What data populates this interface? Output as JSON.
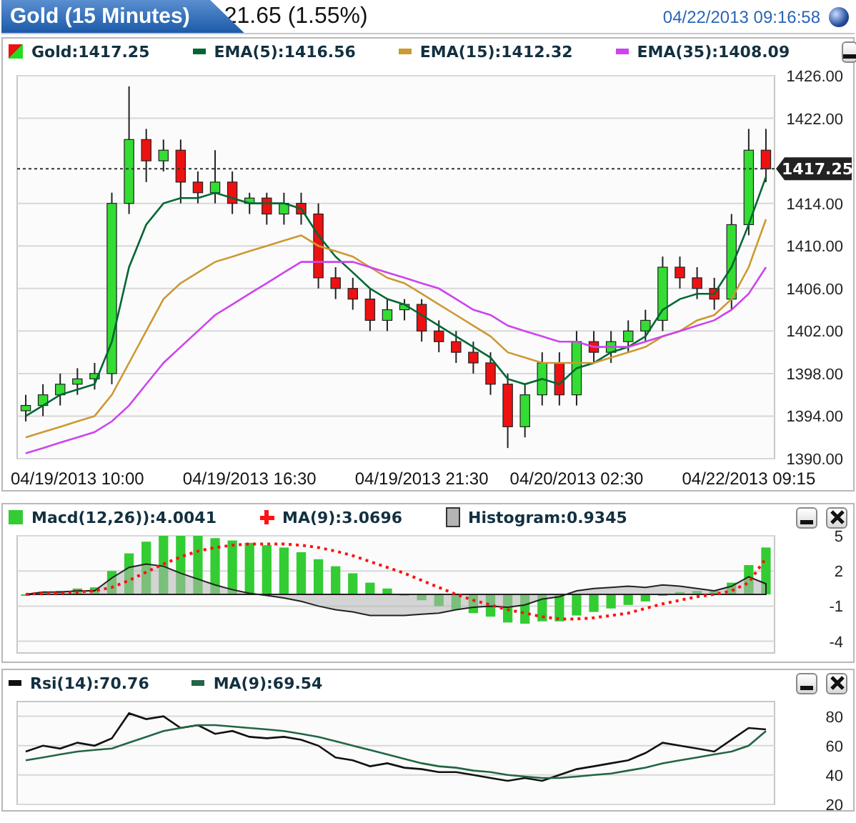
{
  "header": {
    "title": "Gold (15 Minutes)",
    "change": "21.65 (1.55%)",
    "timestamp": "04/22/2013 09:16:58"
  },
  "panels": [
    {
      "kind": "price",
      "closable": false,
      "legend": [
        {
          "kind": "candle",
          "label": "Gold:1417.25"
        },
        {
          "kind": "dash",
          "reading": ":1416.56"
        },
        {
          "kind": "dash",
          "reading": ":1412.32"
        },
        {
          "kind": "dash",
          "reading": ":1408.09"
        }
      ],
      "chart_data": {
        "type": "candlestick",
        "grid": true,
        "categories": [
          null,
          null,
          null,
          "04/19/2013 10:00",
          null,
          null,
          null,
          null,
          null,
          null,
          null,
          null,
          null,
          "04/19/2013 16:30",
          null,
          null,
          null,
          null,
          null,
          null,
          null,
          null,
          null,
          "04/19/2013 21:30",
          null,
          null,
          null,
          null,
          null,
          null,
          null,
          null,
          "04/20/2013 02:30",
          null,
          null,
          null,
          null,
          null,
          null,
          null,
          null,
          null,
          "04/22/2013 09:15",
          null
        ],
        "ylim": [
          1390,
          1426
        ],
        "yticks": [
          {
            "value": 1426,
            "label": "1426.00"
          },
          {
            "value": 1422,
            "label": "1422.00"
          },
          {
            "value": 1414,
            "label": "1414.00"
          },
          {
            "value": 1410,
            "label": "1410.00"
          },
          {
            "value": 1406,
            "label": "1406.00"
          },
          {
            "value": 1402,
            "label": "1402.00"
          },
          {
            "value": 1398,
            "label": "1398.00"
          },
          {
            "value": 1394,
            "label": "1394.00"
          },
          {
            "value": 1390,
            "label": "1390.00"
          }
        ],
        "ref_lines": [
          {
            "axis": "y",
            "value": 1417.25,
            "label": "1417.25"
          }
        ],
        "ohlc": [
          [
            1394.5,
            1396,
            1393.5,
            1395
          ],
          [
            1395,
            1397,
            1394,
            1396
          ],
          [
            1396,
            1398,
            1395,
            1397
          ],
          [
            1397,
            1398.5,
            1396,
            1397.5
          ],
          [
            1397.5,
            1399,
            1396.5,
            1398
          ],
          [
            1398,
            1415,
            1397,
            1414
          ],
          [
            1414,
            1425,
            1413,
            1420
          ],
          [
            1420,
            1421,
            1416,
            1418
          ],
          [
            1418,
            1420,
            1417,
            1419
          ],
          [
            1419,
            1420,
            1414,
            1416
          ],
          [
            1416,
            1417,
            1414,
            1415
          ],
          [
            1415,
            1419,
            1414,
            1416
          ],
          [
            1416,
            1417,
            1413,
            1414
          ],
          [
            1414,
            1415,
            1413,
            1414.5
          ],
          [
            1414.5,
            1415,
            1412,
            1413
          ],
          [
            1413,
            1415,
            1412,
            1414
          ],
          [
            1414,
            1415,
            1412,
            1413
          ],
          [
            1413,
            1414,
            1406,
            1407
          ],
          [
            1407,
            1408,
            1405,
            1406
          ],
          [
            1406,
            1407,
            1404,
            1405
          ],
          [
            1405,
            1406,
            1402,
            1403
          ],
          [
            1403,
            1405,
            1402,
            1404
          ],
          [
            1404,
            1405,
            1403,
            1404.5
          ],
          [
            1404.5,
            1405,
            1401,
            1402
          ],
          [
            1402,
            1403,
            1400,
            1401
          ],
          [
            1401,
            1402,
            1399,
            1400
          ],
          [
            1400,
            1401,
            1398,
            1399
          ],
          [
            1399,
            1400,
            1396,
            1397
          ],
          [
            1397,
            1398,
            1391,
            1393
          ],
          [
            1393,
            1397,
            1392,
            1396
          ],
          [
            1396,
            1400,
            1395,
            1399
          ],
          [
            1399,
            1400,
            1395,
            1396
          ],
          [
            1396,
            1402,
            1395,
            1401
          ],
          [
            1401,
            1402,
            1399,
            1400
          ],
          [
            1400,
            1402,
            1399,
            1401
          ],
          [
            1401,
            1403,
            1400,
            1402
          ],
          [
            1402,
            1404,
            1401,
            1403
          ],
          [
            1403,
            1409,
            1402,
            1408
          ],
          [
            1408,
            1409,
            1406,
            1407
          ],
          [
            1407,
            1408,
            1405,
            1406
          ],
          [
            1406,
            1407,
            1404,
            1405
          ],
          [
            1405,
            1413,
            1404,
            1412
          ],
          [
            1412,
            1421,
            1411,
            1419
          ],
          [
            1419,
            1421,
            1416,
            1417.25
          ]
        ],
        "series": [
          {
            "name": "EMA(5)",
            "type": "line",
            "color": "#006633",
            "values": [
              1394,
              1395,
              1396,
              1396.5,
              1397,
              1401,
              1408,
              1412,
              1414,
              1414.5,
              1414.5,
              1415,
              1414.5,
              1414,
              1414,
              1414,
              1413.5,
              1411,
              1409,
              1407.5,
              1406,
              1405,
              1404.5,
              1403.5,
              1402.5,
              1401.5,
              1400.5,
              1399.5,
              1397.5,
              1397,
              1397.5,
              1397,
              1398.5,
              1399,
              1400,
              1400.5,
              1401.5,
              1404,
              1405,
              1405.5,
              1405.5,
              1408,
              1412,
              1416.5
            ]
          },
          {
            "name": "EMA(15)",
            "type": "line",
            "color": "#cc9933",
            "values": [
              1392,
              1392.5,
              1393,
              1393.5,
              1394,
              1396,
              1399,
              1402,
              1405,
              1406.5,
              1407.5,
              1408.5,
              1409,
              1409.5,
              1410,
              1410.5,
              1411,
              1410,
              1409.5,
              1409,
              1408,
              1407,
              1406.5,
              1405.5,
              1404.5,
              1403.5,
              1402.5,
              1401.5,
              1400,
              1399.5,
              1399,
              1399,
              1399,
              1399,
              1399.5,
              1400,
              1400.5,
              1401.5,
              1402,
              1403,
              1403.5,
              1405,
              1408,
              1412.5
            ]
          },
          {
            "name": "EMA(35)",
            "type": "line",
            "color": "#cc44ee",
            "values": [
              1390.5,
              1391,
              1391.5,
              1392,
              1392.5,
              1393.5,
              1395,
              1397,
              1399,
              1400.5,
              1402,
              1403.5,
              1404.5,
              1405.5,
              1406.5,
              1407.5,
              1408.5,
              1408.5,
              1408.5,
              1408.5,
              1408,
              1407.5,
              1407,
              1406.5,
              1406,
              1405,
              1404,
              1403.5,
              1402.5,
              1402,
              1401.5,
              1401,
              1401,
              1400.5,
              1400.5,
              1400.5,
              1401,
              1401.5,
              1402,
              1402.5,
              1403,
              1404,
              1405.5,
              1408
            ]
          }
        ]
      }
    },
    {
      "kind": "macd",
      "closable": true,
      "legend": [
        {
          "kind": "square",
          "reading": ":4.0041"
        },
        {
          "kind": "plus",
          "reading": ":3.0696"
        },
        {
          "kind": "block",
          "reading": ":0.9345"
        }
      ],
      "chart_data": {
        "type": "bar",
        "grid": true,
        "ylim": [
          -5,
          5
        ],
        "yticks": [
          5,
          2,
          -1,
          -4
        ],
        "categories": [
          null,
          null,
          null,
          null,
          null,
          null,
          null,
          null,
          null,
          null,
          null,
          null,
          null,
          null,
          null,
          null,
          null,
          null,
          null,
          null,
          null,
          null,
          null,
          null,
          null,
          null,
          null,
          null,
          null,
          null,
          null,
          null,
          null,
          null,
          null,
          null,
          null,
          null,
          null,
          null,
          null,
          null,
          null,
          null
        ],
        "series": [
          {
            "name": "Macd(12,26))",
            "type": "bar",
            "color": "#33cc33",
            "values": [
              0,
              0.2,
              0.3,
              0.5,
              0.6,
              2,
              3.5,
              4.5,
              5,
              5,
              5,
              4.8,
              4.6,
              4.4,
              4.2,
              4,
              3.6,
              3,
              2.4,
              1.8,
              1,
              0.5,
              0,
              -0.5,
              -1,
              -1.3,
              -1.6,
              -1.9,
              -2.4,
              -2.5,
              -2.3,
              -2.3,
              -1.8,
              -1.5,
              -1.2,
              -0.9,
              -0.6,
              0,
              0.2,
              0.3,
              0.3,
              1,
              2.5,
              4
            ]
          },
          {
            "name": "MA(9)",
            "type": "line",
            "line_style": "dotted",
            "color": "#ff1111",
            "values": [
              0,
              0.1,
              0.1,
              0.2,
              0.3,
              0.6,
              1.2,
              1.9,
              2.6,
              3.2,
              3.7,
              4,
              4.2,
              4.3,
              4.3,
              4.3,
              4.2,
              4,
              3.7,
              3.3,
              2.8,
              2.3,
              1.8,
              1.2,
              0.6,
              0,
              -0.5,
              -0.9,
              -1.3,
              -1.6,
              -1.9,
              -2.1,
              -2.1,
              -2,
              -1.8,
              -1.6,
              -1.2,
              -0.8,
              -0.5,
              -0.2,
              0,
              0.3,
              1,
              3.1
            ]
          },
          {
            "name": "Histogram",
            "type": "area",
            "color": "#b4b4b4",
            "values": [
              0,
              0.2,
              0.2,
              0.3,
              0.3,
              1.4,
              2.3,
              2.6,
              2.4,
              1.8,
              1.3,
              0.8,
              0.4,
              0.1,
              -0.1,
              -0.3,
              -0.6,
              -1,
              -1.3,
              -1.5,
              -1.8,
              -1.8,
              -1.8,
              -1.7,
              -1.6,
              -1.3,
              -1.1,
              -1,
              -1.1,
              -0.9,
              -0.4,
              -0.2,
              0.3,
              0.5,
              0.6,
              0.7,
              0.6,
              0.8,
              0.7,
              0.5,
              0.3,
              0.7,
              1.5,
              0.9
            ]
          }
        ]
      }
    },
    {
      "kind": "rsi",
      "closable": true,
      "legend": [
        {
          "kind": "dash",
          "reading": ":70.76"
        },
        {
          "kind": "dash",
          "reading": ":69.54"
        }
      ],
      "chart_data": {
        "type": "line",
        "grid": true,
        "ylim": [
          20,
          90
        ],
        "yticks": [
          80,
          60,
          40,
          20
        ],
        "categories": [
          null,
          null,
          null,
          null,
          null,
          null,
          null,
          null,
          null,
          null,
          null,
          null,
          null,
          null,
          null,
          null,
          null,
          null,
          null,
          null,
          null,
          null,
          null,
          null,
          null,
          null,
          null,
          null,
          null,
          null,
          null,
          null,
          null,
          null,
          null,
          null,
          null,
          null,
          null,
          null,
          null,
          null,
          null,
          null
        ],
        "series": [
          {
            "name": "Rsi(14)",
            "type": "line",
            "color": "#111111",
            "values": [
              56,
              60,
              58,
              62,
              60,
              65,
              82,
              78,
              80,
              72,
              74,
              68,
              70,
              66,
              65,
              66,
              64,
              60,
              52,
              50,
              46,
              48,
              45,
              44,
              42,
              42,
              40,
              38,
              36,
              38,
              36,
              40,
              44,
              46,
              48,
              50,
              55,
              62,
              60,
              58,
              56,
              64,
              72,
              71
            ]
          },
          {
            "name": "MA(9)",
            "type": "line",
            "color": "#226644",
            "values": [
              50,
              52,
              54,
              56,
              57,
              58,
              62,
              66,
              70,
              72,
              74,
              74,
              73,
              72,
              71,
              70,
              68,
              66,
              63,
              60,
              57,
              54,
              51,
              48,
              46,
              45,
              43,
              42,
              40,
              39,
              38,
              38,
              39,
              40,
              41,
              43,
              45,
              48,
              50,
              52,
              54,
              56,
              60,
              70
            ]
          }
        ]
      }
    }
  ]
}
